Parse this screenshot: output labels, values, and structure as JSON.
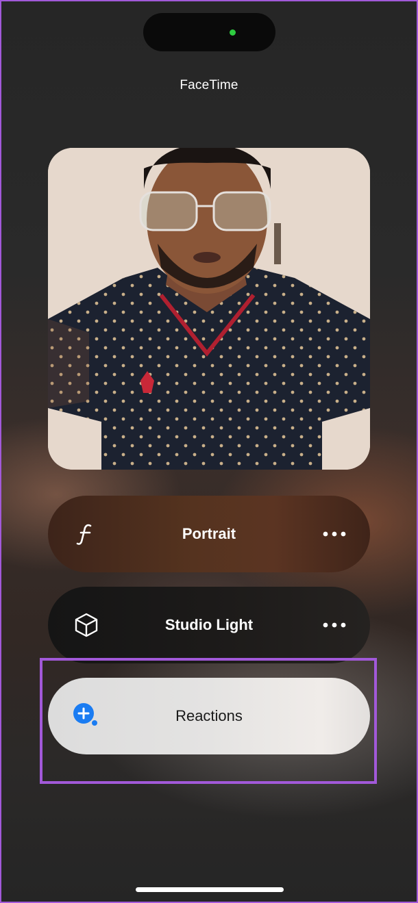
{
  "status": {
    "camera_indicator_color": "#2ecc40"
  },
  "app": {
    "title": "FaceTime"
  },
  "video": {
    "preview": "self-view-camera-feed"
  },
  "controls": [
    {
      "label": "Portrait",
      "icon": "portrait-f-icon",
      "more_icon": "more-icon"
    },
    {
      "label": "Studio Light",
      "icon": "cube-icon",
      "more_icon": "more-icon"
    },
    {
      "label": "Reactions",
      "icon": "reactions-plus-bubble-icon",
      "icon_color": "#1a7cf2"
    }
  ],
  "highlight_color": "#a259d9"
}
